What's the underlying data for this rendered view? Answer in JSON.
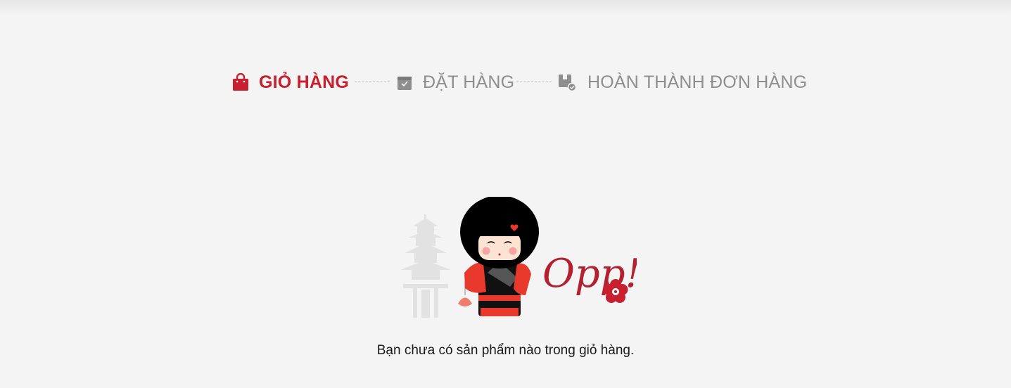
{
  "steps": [
    {
      "label": "GIỎ HÀNG",
      "icon": "shopping-bag-icon",
      "state": "active"
    },
    {
      "label": "ĐẶT HÀNG",
      "icon": "box-icon",
      "state": "inactive"
    },
    {
      "label": "HOÀN THÀNH ĐƠN HÀNG",
      "icon": "box-check-icon",
      "state": "inactive"
    }
  ],
  "empty_cart": {
    "illustration_text": "Opp!",
    "message": "Bạn chưa có sản phẩm nào trong giỏ hàng."
  },
  "colors": {
    "accent": "#c8202f",
    "inactive": "#8e8e8e",
    "background": "#f4f4f4"
  }
}
